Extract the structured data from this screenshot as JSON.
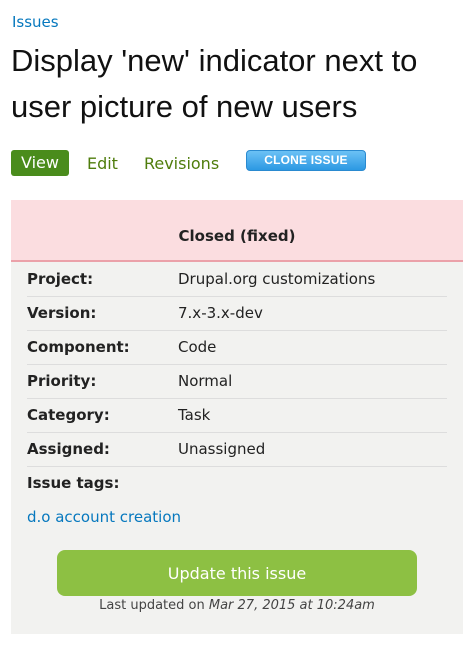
{
  "breadcrumb": {
    "label": "Issues"
  },
  "title": "Display 'new' indicator next to user picture of new users",
  "tabs": [
    {
      "label": "View",
      "active": true
    },
    {
      "label": "Edit",
      "active": false
    },
    {
      "label": "Revisions",
      "active": false
    }
  ],
  "clone_button": {
    "label": "CLONE ISSUE"
  },
  "status": {
    "label": "Closed (fixed)",
    "color": "#fbdde0"
  },
  "metadata": [
    {
      "label": "Project:",
      "value": "Drupal.org customizations"
    },
    {
      "label": "Version:",
      "value": "7.x-3.x-dev"
    },
    {
      "label": "Component:",
      "value": "Code"
    },
    {
      "label": "Priority:",
      "value": "Normal"
    },
    {
      "label": "Category:",
      "value": "Task"
    },
    {
      "label": "Assigned:",
      "value": "Unassigned"
    },
    {
      "label": "Issue tags:",
      "value": ""
    }
  ],
  "issue_tags": [
    "d.o account creation"
  ],
  "update_button": {
    "label": "Update this issue"
  },
  "last_updated": {
    "prefix": "Last updated on",
    "datetime": "Mar 27, 2015 at 10:24am"
  },
  "colors": {
    "link": "#0678be",
    "tab_active": "#4a8c1c",
    "tab_link": "#4f7d0c",
    "clone_button": "#3aa3e8",
    "update_button": "#8dc043"
  }
}
